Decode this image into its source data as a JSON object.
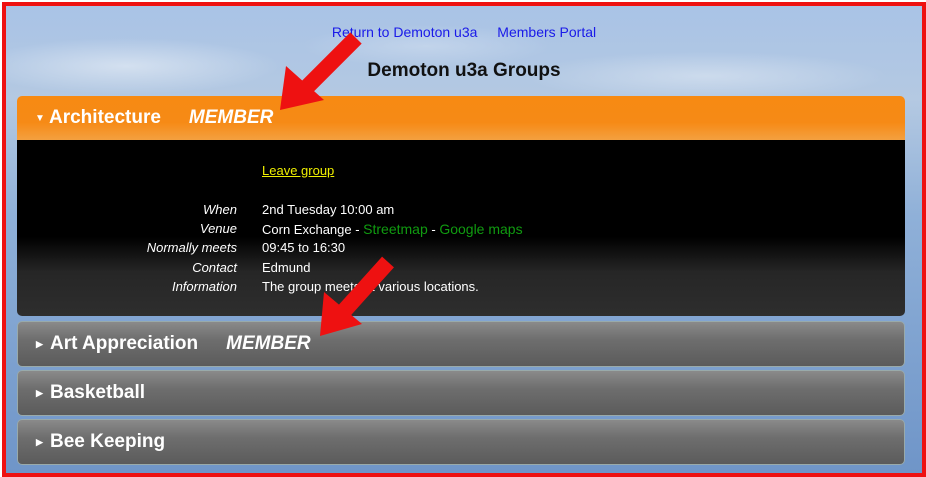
{
  "nav": {
    "return_link": "Return to Demoton u3a",
    "members_link": "Members Portal"
  },
  "page": {
    "title": "Demoton u3a Groups"
  },
  "groups": [
    {
      "name": "Architecture",
      "badge": "MEMBER",
      "expanded": true,
      "leave_label": "Leave group",
      "details": {
        "when_label": "When",
        "when_value": "2nd Tuesday 10:00 am",
        "venue_label": "Venue",
        "venue_value": "Corn Exchange - ",
        "venue_map1": "Streetmap",
        "venue_sep": " - ",
        "venue_map2": "Google maps",
        "meets_label": "Normally meets",
        "meets_value": "09:45 to 16:30",
        "contact_label": "Contact",
        "contact_value": "Edmund",
        "info_label": "Information",
        "info_value": "The group meets at various locations."
      }
    },
    {
      "name": "Art Appreciation",
      "badge": "MEMBER",
      "expanded": false
    },
    {
      "name": "Basketball",
      "badge": "",
      "expanded": false
    },
    {
      "name": "Bee Keeping",
      "badge": "",
      "expanded": false
    }
  ],
  "colors": {
    "active_header": "#f68a16",
    "frame_border": "#ee1111",
    "annotation_arrow": "#ee1111",
    "link_green": "#109b10",
    "leave_yellow": "#f0f000"
  },
  "icons": {
    "expanded": "caret-down-icon",
    "collapsed": "caret-right-icon",
    "annotation": "red-arrow-icon"
  }
}
